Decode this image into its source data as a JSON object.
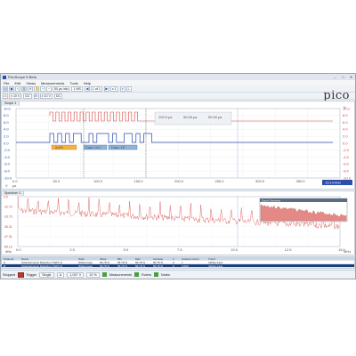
{
  "window": {
    "title": "PicoScope 6 Beta",
    "min": "–",
    "max": "□",
    "close": "✕"
  },
  "menu": [
    "File",
    "Edit",
    "Views",
    "Measurements",
    "Tools",
    "Help"
  ],
  "toolbar": {
    "timebase": "50 µs /div",
    "samples": "1 MS",
    "page": "1 of 1",
    "zoom": "x 1",
    "chA_range": "± 10 V",
    "chA_coupling": "DC",
    "chB_range": "± 10 V",
    "chB_coupling": "DC"
  },
  "logo": "pico",
  "scope": {
    "tab": "Scope 1",
    "left_ticks": [
      "10.0",
      "8.0",
      "6.0",
      "4.0",
      "2.0",
      "0.0",
      "-2.0",
      "-4.0",
      "-6.0",
      "-8.0",
      "-10.0"
    ],
    "right_ticks": [
      "10.0",
      "8.0",
      "6.0",
      "4.0",
      "2.0",
      "0.0",
      "-2.0",
      "-4.0",
      "-6.0",
      "-8.0",
      "-10.0"
    ],
    "x_ticks": [
      "0.0",
      "50.0",
      "100.0",
      "150.0",
      "200.0",
      "250.0",
      "300.0",
      "350.0",
      "400.0"
    ],
    "x_unit": "µs",
    "left_unit": "V",
    "right_unit": "V",
    "zoom_readout": "13.14 kHz",
    "ruler": {
      "t1": "100.0 µs",
      "t2": "50.00 µs",
      "dt": "50.00 µs"
    },
    "decoder": [
      "0x55",
      "Data: 0x1",
      "Data: 1E"
    ],
    "colors": {
      "chA": "#d64541",
      "chB": "#2b4fa8",
      "grid": "#e6e8ec",
      "decode": "#f5b041"
    }
  },
  "spectrum": {
    "tab": "Spectrum 1",
    "y_ticks": [
      "0.0",
      "-12.73",
      "-23.73",
      "-35.31",
      "-47.31",
      "-59.13"
    ],
    "x_ticks": [
      "0.0",
      "2.5",
      "5.0",
      "7.5",
      "10.0",
      "12.5",
      "15.0"
    ],
    "x_unit": "MHz",
    "y_unit": "dBu",
    "overview_title": "Zoom Overview"
  },
  "measurements": {
    "headers": [
      "Channel",
      "Name",
      "Span",
      "Value",
      "Min",
      "Max",
      "Average",
      "σ",
      "Capture Count",
      "Trend"
    ],
    "rows": [
      [
        "A",
        "Total Harmonic Distortion (THD) %",
        "Whole trace",
        "56.78 %",
        "56.78 %",
        "56.78 %",
        "56.78 %",
        "0",
        "1",
        "Infinite trace"
      ],
      [
        "B",
        "Total Harmonic Distortion (THD) %",
        "Whole trace",
        "56.78 %",
        "56.78 %",
        "56.78 %",
        "56.78 %",
        "0",
        "2,000",
        "Infinite trace"
      ]
    ]
  },
  "status": {
    "state": "Stopped",
    "trigger_label": "Trigger",
    "trigger_mode": "Single",
    "trigger_source": "A",
    "trigger_level": "1,037 V",
    "pretrigger": "10 %",
    "measurements_label": "Measurements",
    "rulers_label": "Rulers",
    "notes_label": "Notes"
  }
}
